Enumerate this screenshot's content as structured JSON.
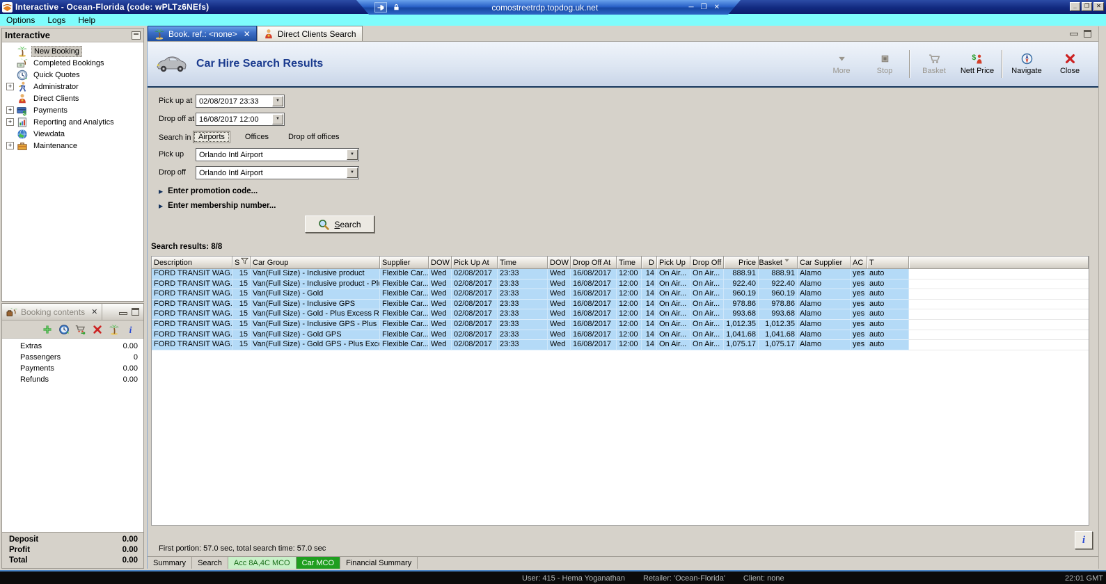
{
  "window": {
    "title": "Interactive - Ocean-Florida (code: wPLTz6NEfs)",
    "rdp_host": "comostreetrdp.topdog.uk.net",
    "menu": [
      "Options",
      "Logs",
      "Help"
    ]
  },
  "sidebar": {
    "title": "Interactive",
    "items": [
      {
        "label": "New Booking",
        "icon": "palm-icon",
        "selected": true,
        "expandable": false
      },
      {
        "label": "Completed Bookings",
        "icon": "money-icon",
        "expandable": false
      },
      {
        "label": "Quick Quotes",
        "icon": "clock-icon",
        "expandable": false
      },
      {
        "label": "Administrator",
        "icon": "admin-icon",
        "expandable": true
      },
      {
        "label": "Direct Clients",
        "icon": "person-icon",
        "expandable": false
      },
      {
        "label": "Payments",
        "icon": "card-icon",
        "expandable": true
      },
      {
        "label": "Reporting and Analytics",
        "icon": "report-icon",
        "expandable": true
      },
      {
        "label": "Viewdata",
        "icon": "globe-icon",
        "expandable": false
      },
      {
        "label": "Maintenance",
        "icon": "toolbox-icon",
        "expandable": true
      }
    ]
  },
  "booking_contents": {
    "title": "Booking contents",
    "toolbar_icons": [
      "plus-icon",
      "quote-clock-icon",
      "cart-go-icon",
      "delete-icon",
      "palm-icon",
      "info-icon"
    ],
    "rows": [
      {
        "label": "Extras",
        "value": "0.00"
      },
      {
        "label": "Passengers",
        "value": "0"
      },
      {
        "label": "Payments",
        "value": "0.00"
      },
      {
        "label": "Refunds",
        "value": "0.00"
      }
    ],
    "totals": [
      {
        "label": "Deposit",
        "value": "0.00"
      },
      {
        "label": "Profit",
        "value": "0.00"
      },
      {
        "label": "Total",
        "value": "0.00"
      }
    ]
  },
  "main": {
    "tabs": [
      {
        "label": "Book. ref.: <none>",
        "icon": "palm-icon",
        "active": true,
        "closable": true
      },
      {
        "label": "Direct Clients Search",
        "icon": "person-icon",
        "active": false,
        "closable": false
      }
    ],
    "header_title": "Car Hire Search Results",
    "toolbar": [
      {
        "label": "More",
        "icon": "more-icon",
        "disabled": true,
        "group": 0
      },
      {
        "label": "Stop",
        "icon": "stop-icon",
        "disabled": true,
        "group": 0
      },
      {
        "label": "Basket",
        "icon": "basket-icon",
        "disabled": true,
        "group": 1
      },
      {
        "label": "Nett Price",
        "icon": "nett-price-icon",
        "disabled": false,
        "group": 1
      },
      {
        "label": "Navigate",
        "icon": "navigate-icon",
        "disabled": false,
        "group": 2
      },
      {
        "label": "Close",
        "icon": "close-icon",
        "disabled": false,
        "group": 2
      }
    ],
    "form": {
      "pickup_at_label": "Pick up at",
      "pickup_at_value": "02/08/2017 23:33",
      "dropoff_at_label": "Drop off at",
      "dropoff_at_value": "16/08/2017 12:00",
      "search_in_label": "Search in",
      "search_in_options": [
        "Airports",
        "Offices",
        "Drop off offices"
      ],
      "search_in_selected": "Airports",
      "pickup_label": "Pick up",
      "pickup_value": "Orlando Intl Airport",
      "dropoff_label": "Drop off",
      "dropoff_value": "Orlando Intl Airport",
      "promo_label": "Enter promotion code...",
      "membership_label": "Enter membership number...",
      "search_button_label": "Search"
    },
    "results": {
      "summary": "Search results: 8/8",
      "columns": [
        {
          "label": "Description"
        },
        {
          "label": "S",
          "icon": "filter-icon"
        },
        {
          "label": "Car Group"
        },
        {
          "label": "Supplier"
        },
        {
          "label": "DOW"
        },
        {
          "label": "Pick Up At"
        },
        {
          "label": "Time"
        },
        {
          "label": "DOW"
        },
        {
          "label": "Drop Off At"
        },
        {
          "label": "Time"
        },
        {
          "label": "D",
          "align": "right"
        },
        {
          "label": "Pick Up"
        },
        {
          "label": "Drop Off"
        },
        {
          "label": "Price",
          "align": "right"
        },
        {
          "label": "Basket",
          "align": "right",
          "icon": "sort-icon"
        },
        {
          "label": "Car Supplier"
        },
        {
          "label": "AC"
        },
        {
          "label": "T"
        }
      ],
      "rows": [
        [
          "FORD TRANSIT WAG...",
          "15",
          "Van(Full Size) - Inclusive product",
          "Flexible Car...",
          "Wed",
          "02/08/2017",
          "23:33",
          "Wed",
          "16/08/2017",
          "12:00",
          "14",
          "On Air...",
          "On Air...",
          "888.91",
          "888.91",
          "Alamo",
          "yes",
          "auto"
        ],
        [
          "FORD TRANSIT WAG...",
          "15",
          "Van(Full Size) - Inclusive product - Plu...",
          "Flexible Car...",
          "Wed",
          "02/08/2017",
          "23:33",
          "Wed",
          "16/08/2017",
          "12:00",
          "14",
          "On Air...",
          "On Air...",
          "922.40",
          "922.40",
          "Alamo",
          "yes",
          "auto"
        ],
        [
          "FORD TRANSIT WAG...",
          "15",
          "Van(Full Size) - Gold",
          "Flexible Car...",
          "Wed",
          "02/08/2017",
          "23:33",
          "Wed",
          "16/08/2017",
          "12:00",
          "14",
          "On Air...",
          "On Air...",
          "960.19",
          "960.19",
          "Alamo",
          "yes",
          "auto"
        ],
        [
          "FORD TRANSIT WAG...",
          "15",
          "Van(Full Size) - Inclusive GPS",
          "Flexible Car...",
          "Wed",
          "02/08/2017",
          "23:33",
          "Wed",
          "16/08/2017",
          "12:00",
          "14",
          "On Air...",
          "On Air...",
          "978.86",
          "978.86",
          "Alamo",
          "yes",
          "auto"
        ],
        [
          "FORD TRANSIT WAG...",
          "15",
          "Van(Full Size) - Gold - Plus Excess Ref...",
          "Flexible Car...",
          "Wed",
          "02/08/2017",
          "23:33",
          "Wed",
          "16/08/2017",
          "12:00",
          "14",
          "On Air...",
          "On Air...",
          "993.68",
          "993.68",
          "Alamo",
          "yes",
          "auto"
        ],
        [
          "FORD TRANSIT WAG...",
          "15",
          "Van(Full Size) - Inclusive GPS - Plus Ex...",
          "Flexible Car...",
          "Wed",
          "02/08/2017",
          "23:33",
          "Wed",
          "16/08/2017",
          "12:00",
          "14",
          "On Air...",
          "On Air...",
          "1,012.35",
          "1,012.35",
          "Alamo",
          "yes",
          "auto"
        ],
        [
          "FORD TRANSIT WAG...",
          "15",
          "Van(Full Size) - Gold GPS",
          "Flexible Car...",
          "Wed",
          "02/08/2017",
          "23:33",
          "Wed",
          "16/08/2017",
          "12:00",
          "14",
          "On Air...",
          "On Air...",
          "1,041.68",
          "1,041.68",
          "Alamo",
          "yes",
          "auto"
        ],
        [
          "FORD TRANSIT WAG...",
          "15",
          "Van(Full Size) - Gold GPS - Plus Excess...",
          "Flexible Car...",
          "Wed",
          "02/08/2017",
          "23:33",
          "Wed",
          "16/08/2017",
          "12:00",
          "14",
          "On Air...",
          "On Air...",
          "1,075.17",
          "1,075.17",
          "Alamo",
          "yes",
          "auto"
        ]
      ]
    },
    "status_text": "First portion: 57.0 sec, total search time: 57.0 sec",
    "bottom_tabs": [
      {
        "label": "Summary",
        "highlight": "none"
      },
      {
        "label": "Search",
        "highlight": "none"
      },
      {
        "label": "Acc 8A,4C MCO",
        "highlight": "light-green"
      },
      {
        "label": "Car MCO",
        "highlight": "dark-green"
      },
      {
        "label": "Financial Summary",
        "highlight": "none"
      }
    ]
  },
  "taskbar": {
    "user": "User: 415 - Hema Yoganathan",
    "retailer": "Retailer: 'Ocean-Florida'",
    "client": "Client: none",
    "time": "22:01 GMT"
  },
  "colors": {
    "accent_navy": "#16365c",
    "row_highlight": "#b4daf7",
    "menu_cyan": "#7efcfc",
    "tab_green_light": "#c8f0c8",
    "tab_green_dark": "#1f9e1f"
  }
}
